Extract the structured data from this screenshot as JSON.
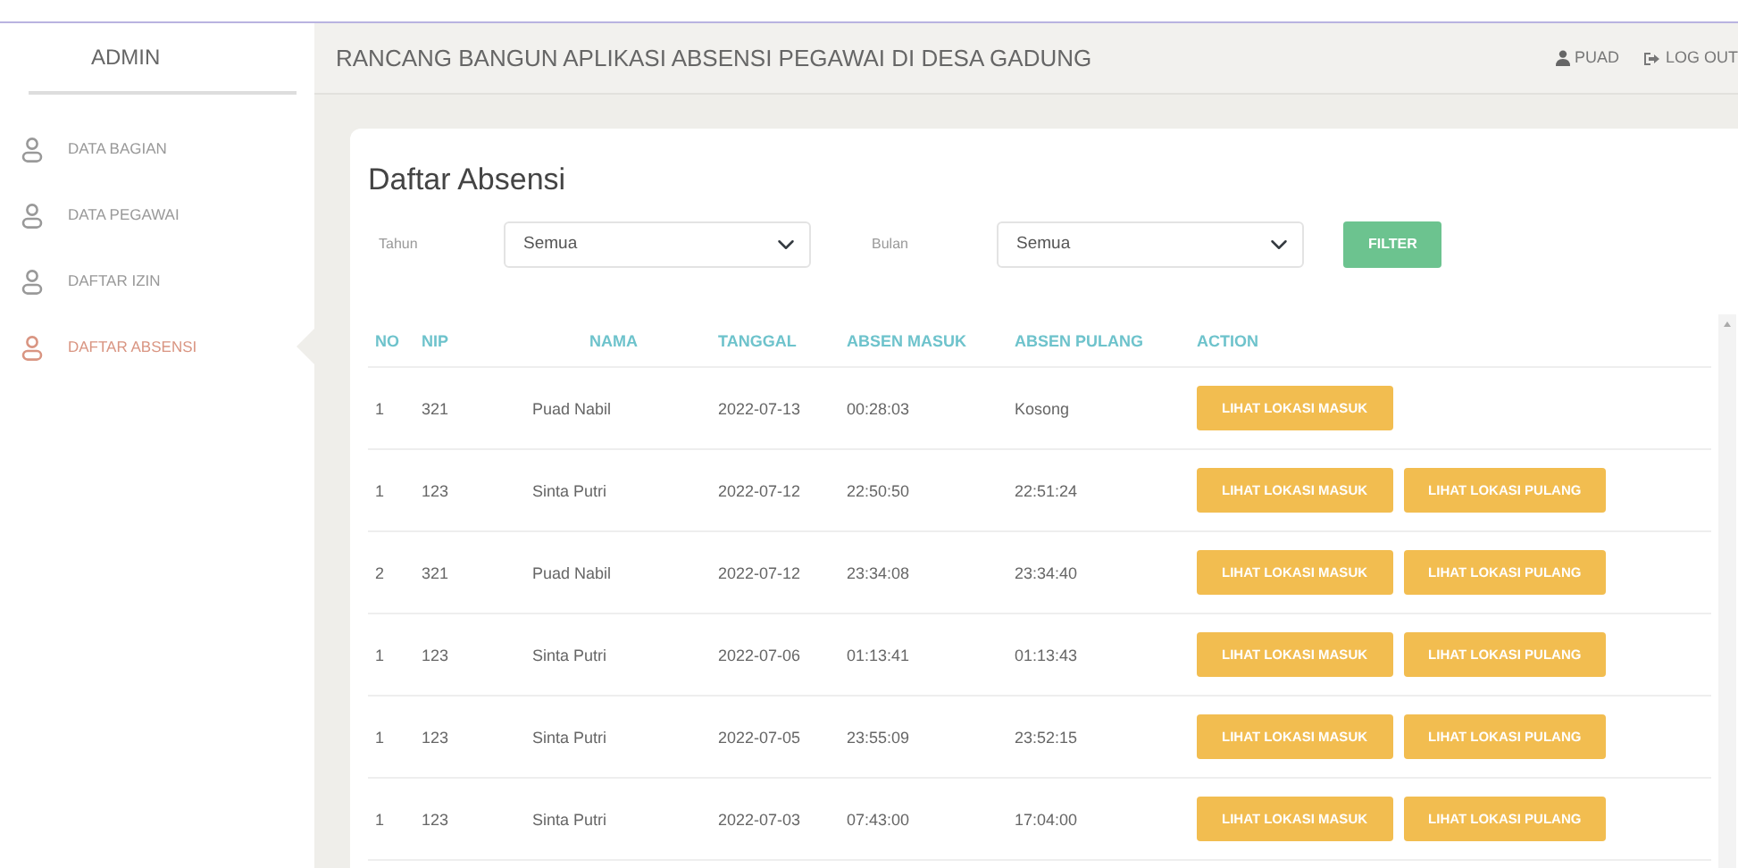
{
  "sidebar": {
    "title": "ADMIN",
    "items": [
      {
        "label": "DATA BAGIAN",
        "selected": false
      },
      {
        "label": "DATA PEGAWAI",
        "selected": false
      },
      {
        "label": "DAFTAR IZIN",
        "selected": false
      },
      {
        "label": "DAFTAR ABSENSI",
        "selected": true
      }
    ]
  },
  "header": {
    "title": "RANCANG BANGUN APLIKASI ABSENSI PEGAWAI DI DESA GADUNG",
    "user": "PUAD",
    "logout": "LOG OUT"
  },
  "card": {
    "title": "Daftar Absensi",
    "filters": [
      {
        "label": "Tahun",
        "value": "Semua"
      },
      {
        "label": "Bulan",
        "value": "Semua"
      }
    ],
    "filter_button": "FILTER"
  },
  "table": {
    "columns": [
      "NO",
      "NIP",
      "NAMA",
      "TANGGAL",
      "ABSEN MASUK",
      "ABSEN PULANG",
      "ACTION"
    ],
    "rows": [
      {
        "cells": [
          "1",
          "321",
          "Puad Nabil",
          "2022-07-13",
          "00:28:03",
          "Kosong"
        ],
        "actions": [
          "LIHAT LOKASI MASUK"
        ]
      },
      {
        "cells": [
          "1",
          "123",
          "Sinta Putri",
          "2022-07-12",
          "22:50:50",
          "22:51:24"
        ],
        "actions": [
          "LIHAT LOKASI MASUK",
          "LIHAT LOKASI PULANG"
        ]
      },
      {
        "cells": [
          "2",
          "321",
          "Puad Nabil",
          "2022-07-12",
          "23:34:08",
          "23:34:40"
        ],
        "actions": [
          "LIHAT LOKASI MASUK",
          "LIHAT LOKASI PULANG"
        ]
      },
      {
        "cells": [
          "1",
          "123",
          "Sinta Putri",
          "2022-07-06",
          "01:13:41",
          "01:13:43"
        ],
        "actions": [
          "LIHAT LOKASI MASUK",
          "LIHAT LOKASI PULANG"
        ]
      },
      {
        "cells": [
          "1",
          "123",
          "Sinta Putri",
          "2022-07-05",
          "23:55:09",
          "23:52:15"
        ],
        "actions": [
          "LIHAT LOKASI MASUK",
          "LIHAT LOKASI PULANG"
        ]
      },
      {
        "cells": [
          "1",
          "123",
          "Sinta Putri",
          "2022-07-03",
          "07:43:00",
          "17:04:00"
        ],
        "actions": [
          "LIHAT LOKASI MASUK",
          "LIHAT LOKASI PULANG"
        ]
      }
    ]
  }
}
